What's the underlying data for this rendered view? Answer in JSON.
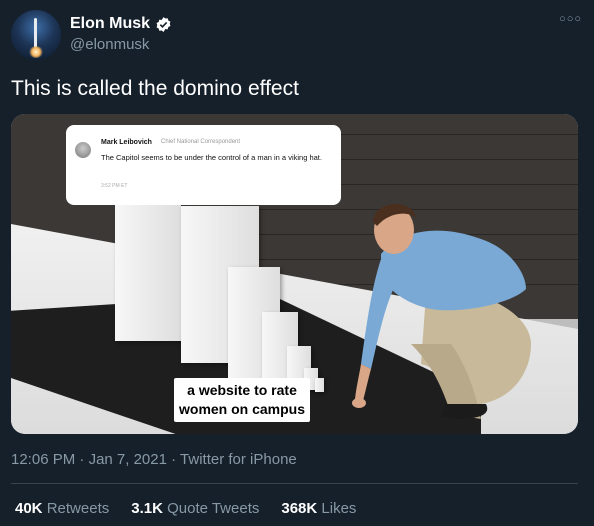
{
  "author": {
    "name": "Elon Musk",
    "handle": "@elonmusk"
  },
  "tweet": {
    "text": "This is called the domino effect",
    "timestamp": "12:06 PM",
    "date": "Jan 7, 2021",
    "source": "Twitter for iPhone",
    "separator": "·"
  },
  "media": {
    "card": {
      "name": "Mark Leibovich",
      "title": "Chief National Correspondent",
      "text": "The Capitol seems to be under the control of a man in a viking hat.",
      "time": "3:52 PM ET"
    },
    "caption_line1": "a website to rate",
    "caption_line2": "women on campus"
  },
  "stats": [
    {
      "value": "40K",
      "label": "Retweets"
    },
    {
      "value": "3.1K",
      "label": "Quote Tweets"
    },
    {
      "value": "368K",
      "label": "Likes"
    }
  ],
  "colors": {
    "background": "#15202b",
    "secondary_text": "#8899a6",
    "verified": "#1d9bf0"
  },
  "icons": {
    "verified": "verified-badge-icon",
    "more": "more-options-icon"
  }
}
